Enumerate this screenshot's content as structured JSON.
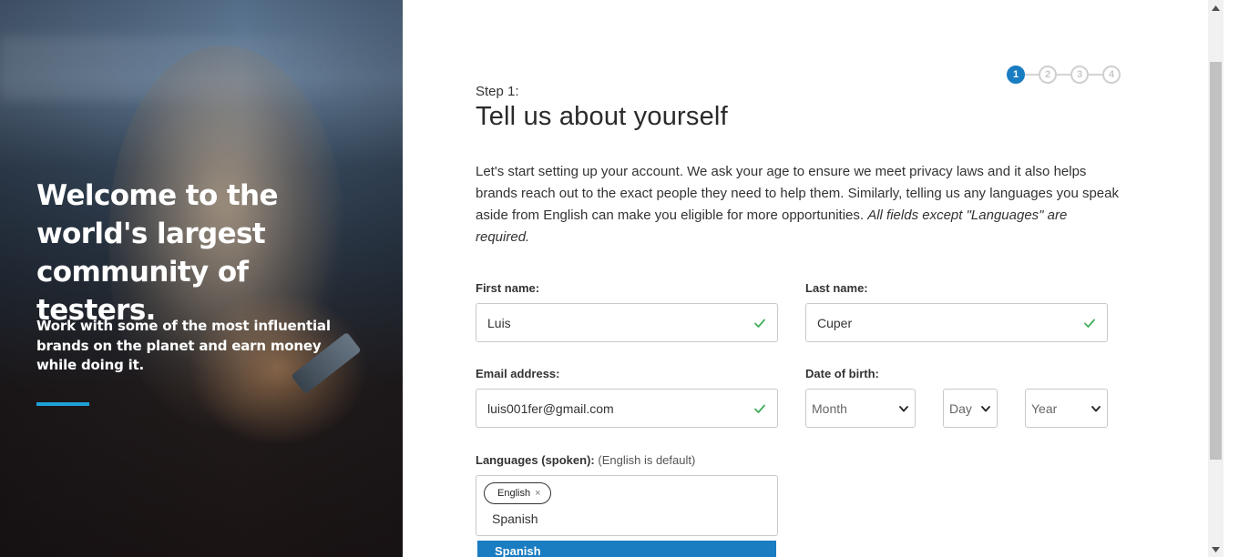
{
  "hero": {
    "headline": "Welcome to the world's largest community of testers.",
    "subtext": "Work with some of the most influential brands on the planet and earn money while doing it.",
    "accent_color": "#1ea2d8"
  },
  "stepper": {
    "steps": [
      "1",
      "2",
      "3",
      "4"
    ],
    "active_step": 1,
    "active_color": "#1a7cc1"
  },
  "step_label": "Step 1:",
  "title": "Tell us about yourself",
  "intro_text": "Let's start setting up your account. We ask your age to ensure we meet privacy laws and it also helps brands reach out to the exact people they need to help them. Similarly, telling us any languages you speak aside from English can make you eligible for more opportunities. ",
  "intro_note": "All fields except \"Languages\" are required.",
  "form": {
    "first_name": {
      "label": "First name:",
      "value": "Luis",
      "valid": true
    },
    "last_name": {
      "label": "Last name:",
      "value": "Cuper",
      "valid": true
    },
    "email": {
      "label": "Email address:",
      "value": "luis001fer@gmail.com",
      "valid": true
    },
    "dob": {
      "label": "Date of birth:",
      "month": "Month",
      "day": "Day",
      "year": "Year"
    },
    "languages": {
      "label": "Languages (spoken):",
      "hint": "(English is default)",
      "tags": [
        "English"
      ],
      "typed": "Spanish",
      "suggestion": "Spanish"
    }
  },
  "icons": {
    "check": "check-icon",
    "chevron": "chevron-down-icon",
    "remove": "×"
  },
  "colors": {
    "valid_check": "#3fae5a",
    "highlight": "#1a7cc1"
  }
}
